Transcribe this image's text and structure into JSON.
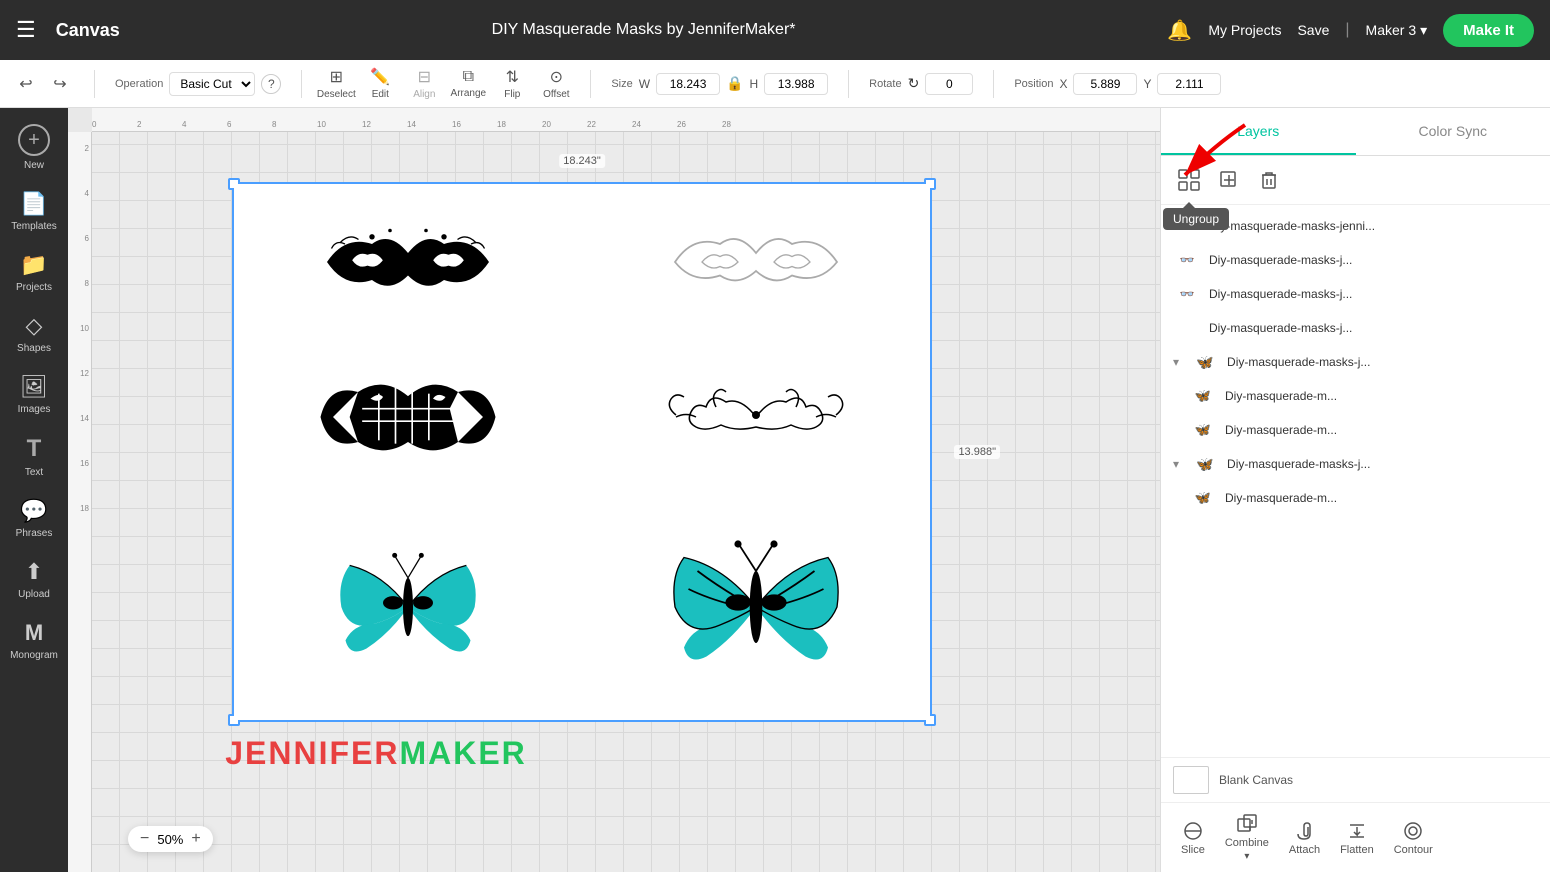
{
  "topbar": {
    "menu_icon": "☰",
    "logo": "Canvas",
    "title": "DIY Masquerade Masks by JenniferMaker*",
    "bell_icon": "🔔",
    "my_projects": "My Projects",
    "save": "Save",
    "divider": "|",
    "maker": "Maker 3",
    "chevron": "▾",
    "make_it": "Make It"
  },
  "toolbar": {
    "undo_icon": "↩",
    "redo_icon": "↪",
    "operation_label": "Operation",
    "operation_value": "Basic Cut",
    "help_icon": "?",
    "deselect_label": "Deselect",
    "edit_label": "Edit",
    "align_label": "Align",
    "arrange_label": "Arrange",
    "flip_label": "Flip",
    "offset_label": "Offset",
    "size_label": "Size",
    "w_label": "W",
    "w_value": "18.243",
    "h_label": "H",
    "h_value": "13.988",
    "lock_icon": "🔒",
    "rotate_label": "Rotate",
    "rotate_value": "0",
    "position_label": "Position",
    "x_label": "X",
    "x_value": "5.889",
    "y_label": "Y",
    "y_value": "2.111"
  },
  "canvas": {
    "zoom": "50%",
    "dim_h": "18.243\"",
    "dim_v": "13.988\"",
    "brand_jennifer": "JENNIFER",
    "brand_maker": "MAKER"
  },
  "right_panel": {
    "tabs": [
      {
        "id": "layers",
        "label": "Layers",
        "active": true
      },
      {
        "id": "color_sync",
        "label": "Color Sync",
        "active": false
      }
    ],
    "layer_toolbar": {
      "ungroup_icon": "⊞",
      "add_icon": "+",
      "delete_icon": "🗑",
      "tooltip": "Ungroup"
    },
    "layers": [
      {
        "id": 1,
        "name": "Diy-masquerade-masks-jenni...",
        "indent": 0,
        "thumb": "👓",
        "has_expand": false
      },
      {
        "id": 2,
        "name": "Diy-masquerade-masks-j...",
        "indent": 0,
        "thumb": "👓",
        "has_expand": false
      },
      {
        "id": 3,
        "name": "Diy-masquerade-masks-j...",
        "indent": 0,
        "thumb": "👓",
        "has_expand": false
      },
      {
        "id": 4,
        "name": "Diy-masquerade-masks-j...",
        "indent": 0,
        "thumb": "",
        "has_expand": false
      },
      {
        "id": 5,
        "name": "Diy-masquerade-masks-j...",
        "indent": 0,
        "thumb": "🦋",
        "has_expand": true,
        "expanded": true
      },
      {
        "id": 6,
        "name": "Diy-masquerade-m...",
        "indent": 1,
        "thumb": "🦋",
        "has_expand": false
      },
      {
        "id": 7,
        "name": "Diy-masquerade-m...",
        "indent": 1,
        "thumb": "🦋",
        "has_expand": false
      },
      {
        "id": 8,
        "name": "Diy-masquerade-masks-j...",
        "indent": 0,
        "thumb": "🦋",
        "has_expand": true,
        "expanded": true
      },
      {
        "id": 9,
        "name": "Diy-masquerade-m...",
        "indent": 1,
        "thumb": "🦋",
        "has_expand": false
      }
    ],
    "blank_canvas": "Blank Canvas",
    "bottom_tools": [
      {
        "id": "slice",
        "label": "Slice",
        "icon": "⊖"
      },
      {
        "id": "combine",
        "label": "Combine",
        "icon": "⊕"
      },
      {
        "id": "attach",
        "label": "Attach",
        "icon": "📎"
      },
      {
        "id": "flatten",
        "label": "Flatten",
        "icon": "⬇"
      },
      {
        "id": "contour",
        "label": "Contour",
        "icon": "◎"
      }
    ]
  },
  "left_sidebar": {
    "items": [
      {
        "id": "new",
        "label": "New",
        "icon": "＋"
      },
      {
        "id": "templates",
        "label": "Templates",
        "icon": "📄"
      },
      {
        "id": "projects",
        "label": "Projects",
        "icon": "📁"
      },
      {
        "id": "shapes",
        "label": "Shapes",
        "icon": "◇"
      },
      {
        "id": "images",
        "label": "Images",
        "icon": "🖼"
      },
      {
        "id": "text",
        "label": "Text",
        "icon": "T"
      },
      {
        "id": "phrases",
        "label": "Phrases",
        "icon": "💬"
      },
      {
        "id": "upload",
        "label": "Upload",
        "icon": "⬆"
      },
      {
        "id": "monogram",
        "label": "Monogram",
        "icon": "M"
      }
    ]
  },
  "ruler": {
    "h_marks": [
      "0",
      "2",
      "4",
      "6",
      "8",
      "10",
      "12",
      "14",
      "16",
      "18",
      "20",
      "22",
      "24",
      "26",
      "28"
    ],
    "v_marks": [
      "2",
      "4",
      "6",
      "8",
      "10",
      "12",
      "14",
      "16",
      "18"
    ]
  }
}
